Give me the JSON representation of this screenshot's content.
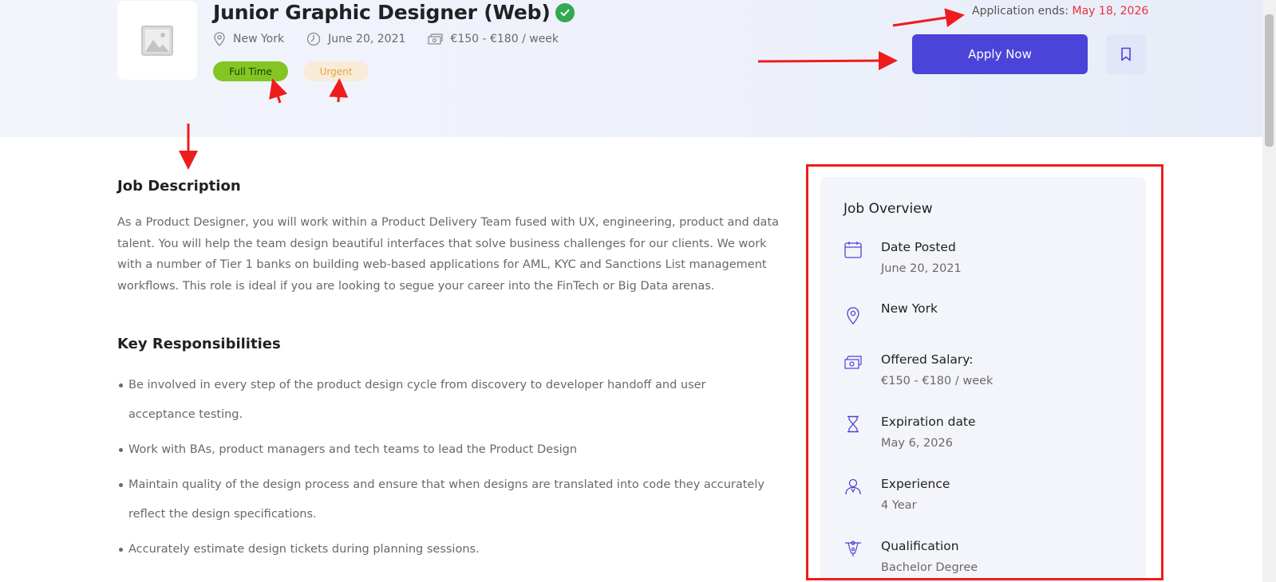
{
  "job": {
    "title": "Junior Graphic Designer (Web)",
    "location": "New York",
    "date": "June 20, 2021",
    "salary": "€150 - €180 / week",
    "tags": [
      "Full Time",
      "Urgent"
    ]
  },
  "application": {
    "ends_label": "Application ends: ",
    "ends_date": "May 18, 2026",
    "apply_label": "Apply Now"
  },
  "description": {
    "heading": "Job Description",
    "text": "As a Product Designer, you will work within a Product Delivery Team fused with UX, engineering, product and data talent. You will help the team design beautiful interfaces that solve business challenges for our clients. We work with a number of Tier 1 banks on building web-based applications for AML, KYC and Sanctions List management workflows. This role is ideal if you are looking to segue your career into the FinTech or Big Data arenas."
  },
  "responsibilities": {
    "heading": "Key Responsibilities",
    "items": [
      "Be involved in every step of the product design cycle from discovery to developer handoff and user acceptance testing.",
      "Work with BAs, product managers and tech teams to lead the Product Design",
      "Maintain quality of the design process and ensure that when designs are translated into code they accurately reflect the design specifications.",
      "Accurately estimate design tickets during planning sessions."
    ]
  },
  "overview": {
    "title": "Job Overview",
    "items": [
      {
        "icon": "calendar-icon",
        "label": "Date Posted",
        "value": "June 20, 2021"
      },
      {
        "icon": "map-pin-icon",
        "label": "New York",
        "value": ""
      },
      {
        "icon": "money-icon",
        "label": "Offered Salary:",
        "value": "€150 - €180 / week"
      },
      {
        "icon": "hourglass-icon",
        "label": "Expiration date",
        "value": "May 6, 2026"
      },
      {
        "icon": "user-icon",
        "label": "Experience",
        "value": "4 Year"
      },
      {
        "icon": "qualification-icon",
        "label": "Qualification",
        "value": "Bachelor Degree"
      }
    ]
  },
  "colors": {
    "accent": "#4a44d8",
    "full_time_tag": "#84c523",
    "urgent_tag": "#f8ecd9",
    "deadline": "#e8323c",
    "annotation": "#ee1c1c"
  }
}
